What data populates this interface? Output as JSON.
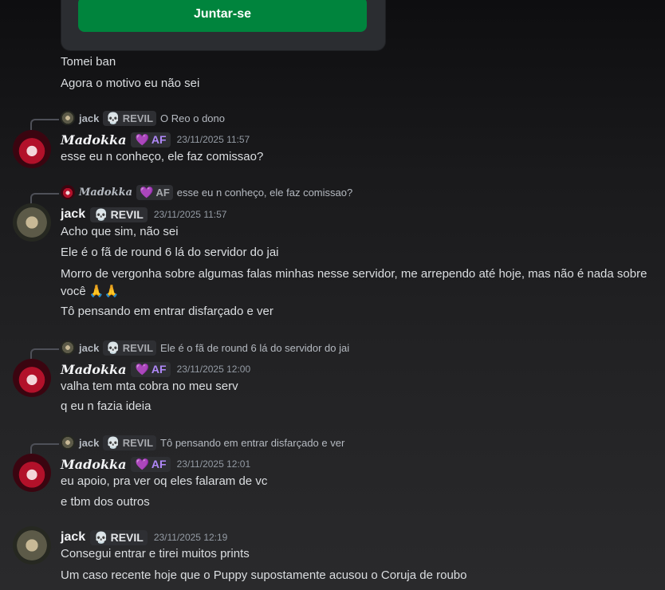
{
  "invite": {
    "join_label": "Juntar-se"
  },
  "top_lines": [
    "Tomei ban",
    "Agora o motivo eu não sei"
  ],
  "users": {
    "madokka": {
      "name": "Madokka",
      "tag": "AF",
      "tag_icon": "💜"
    },
    "jack": {
      "name": "jack",
      "tag": "REVIL",
      "tag_icon": "💀"
    }
  },
  "messages": [
    {
      "reply": {
        "user": "jack",
        "tag": "REVIL",
        "text": "O Reo o dono"
      },
      "author": "Madokka",
      "tag": "AF",
      "time": "23/11/2025 11:57",
      "lines": [
        "esse eu n conheço, ele faz comissao?"
      ]
    },
    {
      "reply": {
        "user": "Madokka",
        "tag": "AF",
        "text": "esse eu n conheço, ele faz comissao?"
      },
      "author": "jack",
      "tag": "REVIL",
      "time": "23/11/2025 11:57",
      "lines": [
        "Acho que sim, não sei",
        "Ele é o fã de round 6 lá do servidor do jai",
        "Morro de vergonha sobre algumas falas minhas nesse servidor, me arrependo até hoje, mas não é nada sobre você 🙏🙏",
        "Tô pensando em entrar disfarçado e ver"
      ]
    },
    {
      "reply": {
        "user": "jack",
        "tag": "REVIL",
        "text": "Ele é o fã de round 6 lá do servidor do jai"
      },
      "author": "Madokka",
      "tag": "AF",
      "time": "23/11/2025 12:00",
      "lines": [
        "valha tem mta cobra no meu serv",
        "q eu n fazia ideia"
      ]
    },
    {
      "reply": {
        "user": "jack",
        "tag": "REVIL",
        "text": "Tô pensando em entrar disfarçado e ver"
      },
      "author": "Madokka",
      "tag": "AF",
      "time": "23/11/2025 12:01",
      "lines": [
        "eu apoio, pra ver oq eles falaram de vc",
        "e tbm dos outros"
      ]
    },
    {
      "author": "jack",
      "tag": "REVIL",
      "time": "23/11/2025 12:19",
      "lines": [
        "Consegui entrar e tirei muitos prints",
        "Um caso recente hoje que o Puppy supostamente acusou o Coruja de roubo"
      ]
    }
  ],
  "colors": {
    "join": "#00843d",
    "background": "#1e1f22",
    "timestamp": "#949ba4"
  }
}
